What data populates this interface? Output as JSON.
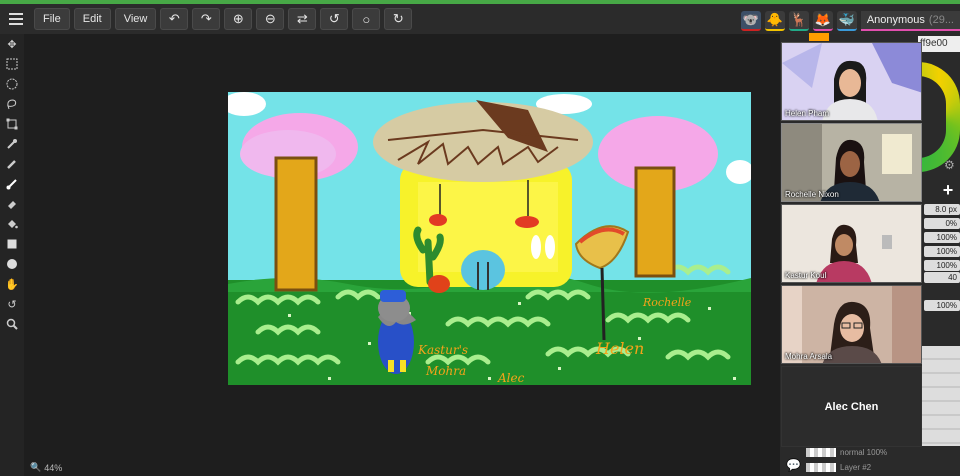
{
  "menu": {
    "file": "File",
    "edit": "Edit",
    "view": "View"
  },
  "toolbar_icons": [
    "undo-icon",
    "redo-icon",
    "zoom-in-icon",
    "zoom-out-icon",
    "swap-icon",
    "rotate-left-icon",
    "circle-icon",
    "rotate-right-icon"
  ],
  "users": {
    "name": "Anonymous",
    "count_suffix": "(29..."
  },
  "tools": [
    "move-icon",
    "select-rect-icon",
    "select-ellipse-icon",
    "lasso-icon",
    "transform-icon",
    "eyedropper-icon",
    "pencil-icon",
    "brush-icon",
    "eraser-icon",
    "bucket-icon",
    "rectangle-icon",
    "ellipse-icon",
    "hand-icon",
    "rotate-icon",
    "zoom-icon"
  ],
  "zoom": {
    "level": "44%"
  },
  "color": {
    "hex": "ff9e00",
    "swatch": "#ff9e00"
  },
  "properties": {
    "size": "8.0 px",
    "p1": "0%",
    "p2": "100%",
    "p3": "100%",
    "p4": "100%",
    "p5": "40",
    "p6": "100%"
  },
  "layers": {
    "blend": "normal 100%",
    "layer_name": "Layer #2"
  },
  "call": {
    "participants": [
      {
        "name": "Helen Pham"
      },
      {
        "name": "Rochelle Nixon"
      },
      {
        "name": "Kastur Koul"
      },
      {
        "name": "Mohra Arsala"
      }
    ],
    "self_name": "Alec Chen"
  },
  "drawing": {
    "sign_rochelle": "Rochelle",
    "sign_kastur": "Kastur's",
    "sign_mohra": "Mohra",
    "sign_alec": "Alec",
    "sign_helen": "Helen"
  }
}
